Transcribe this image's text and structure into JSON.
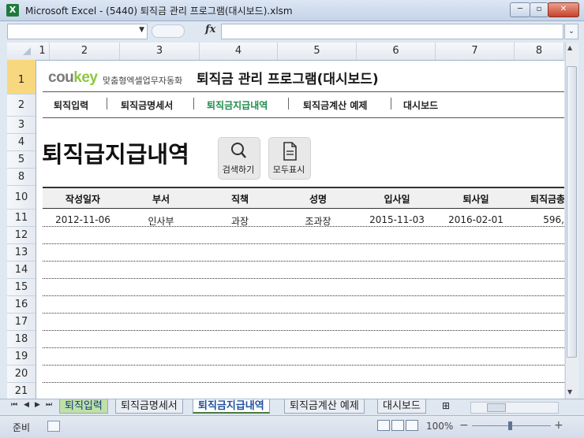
{
  "window": {
    "title": "Microsoft Excel - (5440) 퇴직금 관리 프로그램(대시보드).xlsm",
    "app_icon": "X",
    "minimize": "─",
    "restore": "▫",
    "close": "✕"
  },
  "formula_bar": {
    "name_box": "",
    "name_box_arrow": "▼",
    "fx": "fx",
    "formula": "",
    "expand": "⌄"
  },
  "columns": [
    "1",
    "2",
    "3",
    "4",
    "5",
    "6",
    "7",
    "8"
  ],
  "rows": [
    "1",
    "2",
    "3",
    "4",
    "5",
    "8",
    "10",
    "11",
    "12",
    "13",
    "14",
    "15",
    "16",
    "17",
    "18",
    "19",
    "20",
    "21"
  ],
  "selected_row": "1",
  "header": {
    "logo_main": "cou",
    "logo_accent": "key",
    "logo_sub": "맞춤형엑셀업무자동화",
    "program_title": "퇴직금 관리 프로그램(대시보드)"
  },
  "nav": {
    "items": [
      "퇴직입력",
      "퇴직금명세서",
      "퇴직금지급내역",
      "퇴직금계산 예제",
      "대시보드"
    ],
    "active_index": 2
  },
  "page": {
    "title": "퇴직급지급내역",
    "search_label": "검색하기",
    "show_all_label": "모두표시"
  },
  "table": {
    "headers": [
      "작성일자",
      "부서",
      "직책",
      "성명",
      "입사일",
      "퇴사일",
      "퇴직금총"
    ],
    "rows": [
      [
        "2012-11-06",
        "인사부",
        "과장",
        "조과장",
        "2015-11-03",
        "2016-02-01",
        "596,"
      ]
    ]
  },
  "sheet_tabs": {
    "items": [
      "퇴직입력",
      "퇴직금명세서",
      "퇴직금지급내역",
      "퇴직금계산 예제",
      "대시보드"
    ],
    "active_index": 2,
    "nav_glyphs": [
      "⏮",
      "◀",
      "▶",
      "⏭"
    ]
  },
  "status_bar": {
    "status": "준비",
    "zoom": "100%",
    "zoom_minus": "−",
    "zoom_plus": "+"
  },
  "colors": {
    "active_nav": "#1e8a4a",
    "logo_accent": "#8cc63f",
    "selected_row_header": "#f8d87f"
  }
}
